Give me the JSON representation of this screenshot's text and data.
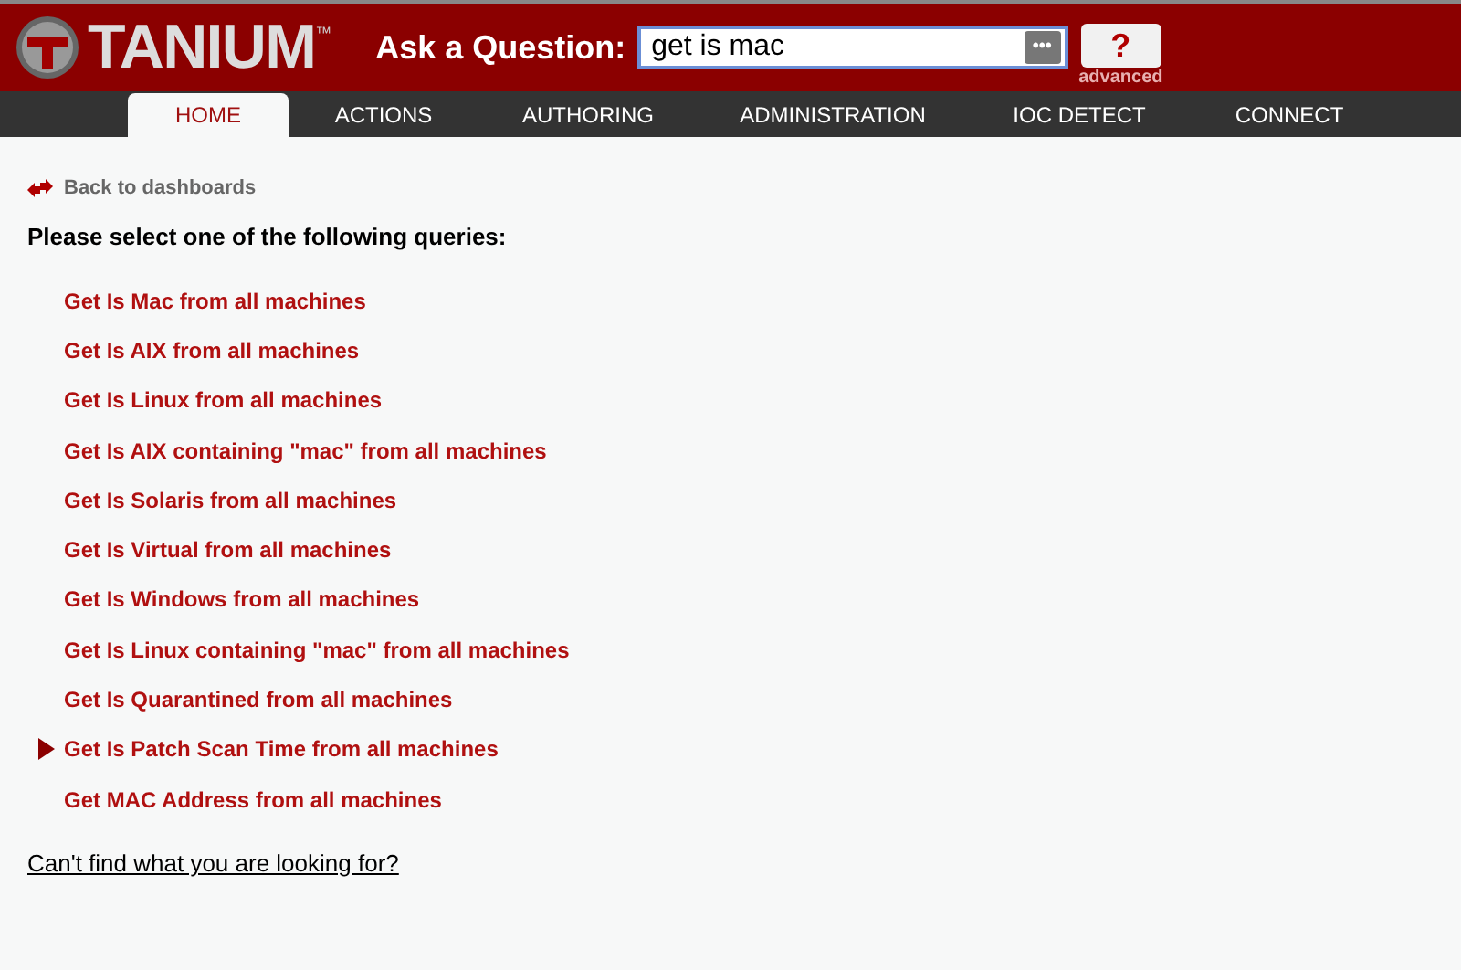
{
  "header": {
    "logo_text": "TANIUM",
    "logo_mark": "™",
    "ask_label": "Ask a Question:",
    "query_value": "get is mac",
    "more_button": "•••",
    "help_button": "?",
    "advanced_link": "advanced"
  },
  "tabs": [
    {
      "label": "HOME",
      "selected": true
    },
    {
      "label": "ACTIONS",
      "selected": false
    },
    {
      "label": "AUTHORING",
      "selected": false
    },
    {
      "label": "ADMINISTRATION",
      "selected": false
    },
    {
      "label": "IOC DETECT",
      "selected": false
    },
    {
      "label": "CONNECT",
      "selected": false
    }
  ],
  "back_link": "Back to dashboards",
  "heading": "Please select one of the following queries:",
  "queries": [
    {
      "label": "Get Is Mac from all machines",
      "selected": false
    },
    {
      "label": "Get Is AIX from all machines",
      "selected": false
    },
    {
      "label": "Get Is Linux from all machines",
      "selected": false
    },
    {
      "label": "Get Is AIX containing \"mac\" from all machines",
      "selected": false
    },
    {
      "label": "Get Is Solaris from all machines",
      "selected": false
    },
    {
      "label": "Get Is Virtual from all machines",
      "selected": false
    },
    {
      "label": "Get Is Windows from all machines",
      "selected": false
    },
    {
      "label": "Get Is Linux containing \"mac\" from all machines",
      "selected": false
    },
    {
      "label": "Get Is Quarantined from all machines",
      "selected": false
    },
    {
      "label": "Get Is Patch Scan Time from all machines",
      "selected": true
    },
    {
      "label": "Get MAC Address from all machines",
      "selected": false
    }
  ],
  "help_link": "Can't find what you are looking for?"
}
